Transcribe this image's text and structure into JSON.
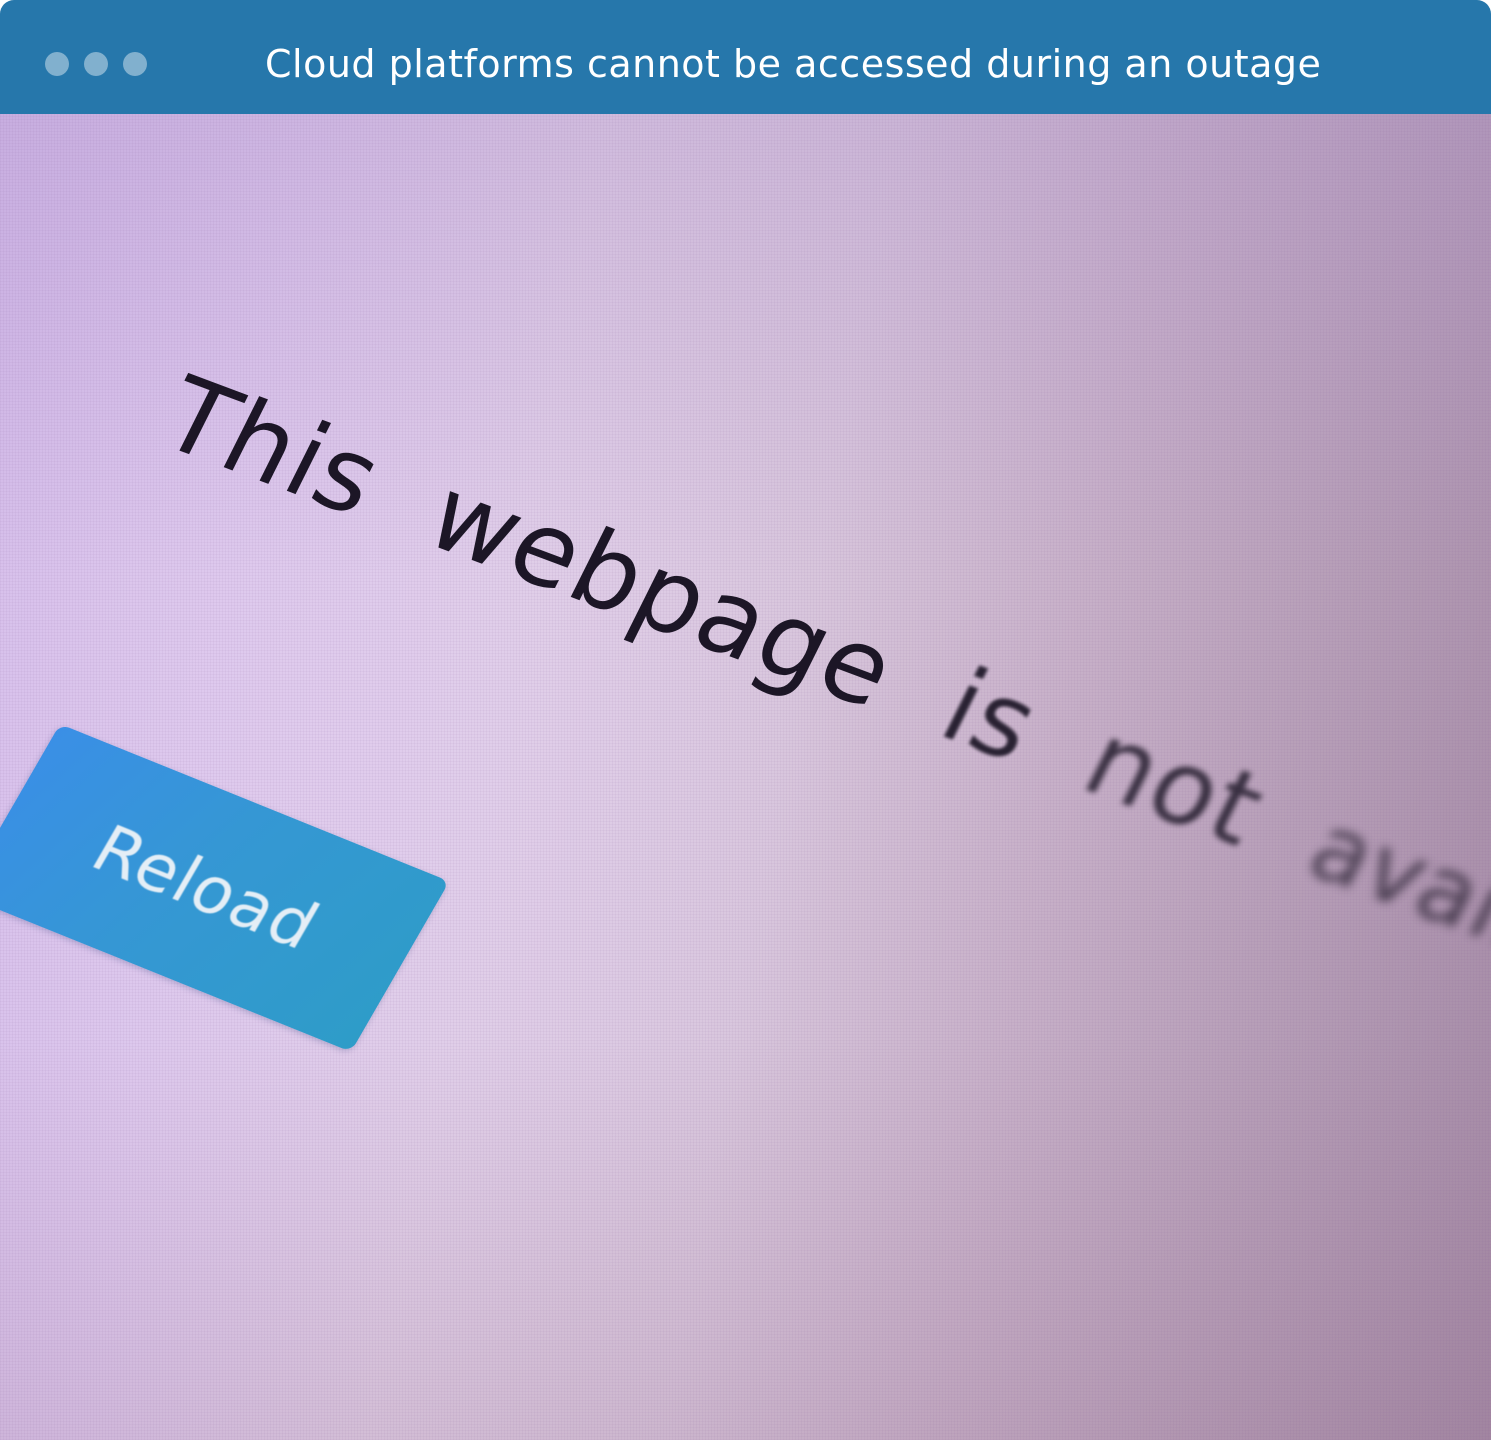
{
  "window": {
    "title": "Cloud platforms cannot be accessed during an outage",
    "titlebar_color": "#2677ab",
    "controls": [
      "window-control-dot",
      "window-control-dot",
      "window-control-dot"
    ]
  },
  "page": {
    "message_words": [
      "This",
      "webpage",
      "is",
      "not",
      "available"
    ],
    "reload_label": "Reload",
    "accent_color": "#3a8fe6"
  }
}
